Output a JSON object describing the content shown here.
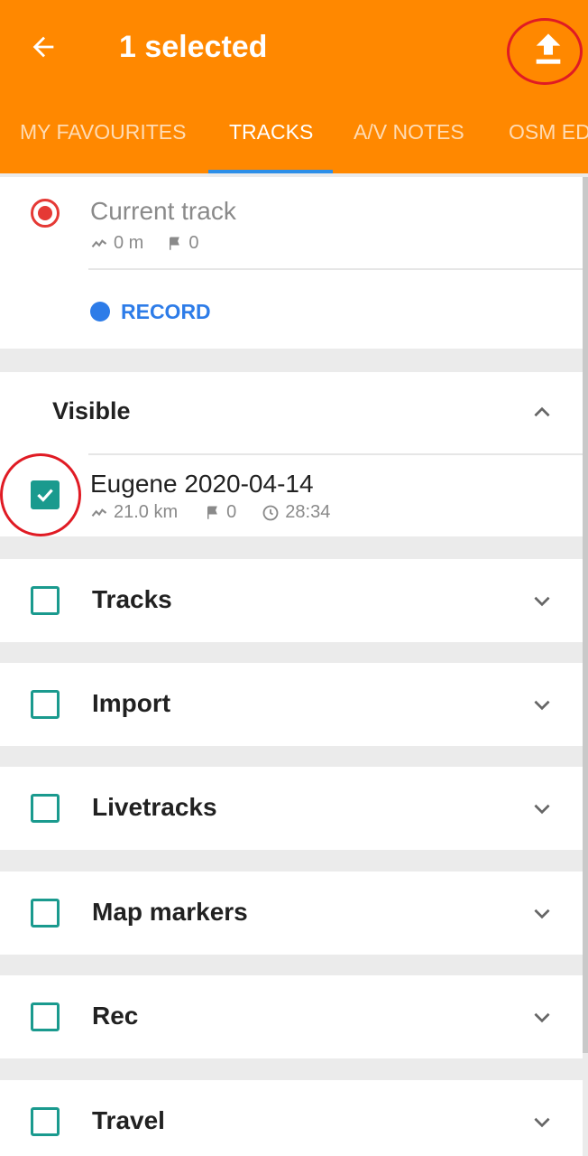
{
  "header": {
    "title": "1 selected",
    "back_icon": "arrow-left-icon",
    "upload_icon": "upload-icon"
  },
  "tabs": [
    {
      "label": "MY FAVOURITES"
    },
    {
      "label": "TRACKS",
      "active": true
    },
    {
      "label": "A/V NOTES"
    },
    {
      "label": "OSM EDITS"
    }
  ],
  "current_track": {
    "title": "Current track",
    "distance": "0 m",
    "waypoints": "0",
    "record_label": "RECORD"
  },
  "visible_section": {
    "title": "Visible",
    "track": {
      "name": "Eugene 2020-04-14",
      "distance": "21.0 km",
      "waypoints": "0",
      "duration": "28:34",
      "checked": true
    }
  },
  "groups": [
    {
      "label": "Tracks"
    },
    {
      "label": "Import"
    },
    {
      "label": "Livetracks"
    },
    {
      "label": "Map markers"
    },
    {
      "label": "Rec"
    },
    {
      "label": "Travel"
    }
  ],
  "colors": {
    "appbar": "#ff8800",
    "accent": "#2d7ce8",
    "checkbox": "#1a9a8e",
    "record": "#e53935",
    "annotation": "#e01b24"
  }
}
